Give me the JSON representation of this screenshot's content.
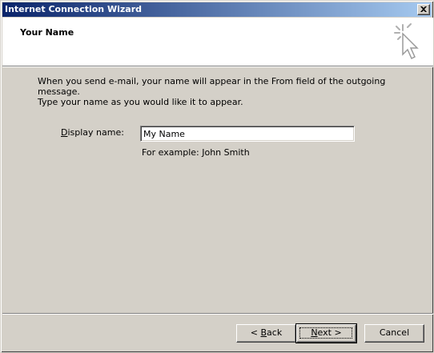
{
  "window": {
    "title": "Internet Connection Wizard"
  },
  "header": {
    "title": "Your Name"
  },
  "main": {
    "description_line1": "When you send e-mail, your name will appear in the From field of the outgoing message.",
    "description_line2": "Type your name as you would like it to appear.",
    "display_name_label_mnemonic": "D",
    "display_name_label_rest": "isplay name:",
    "display_name_value": "My Name",
    "example_text": "For example: John Smith"
  },
  "buttons": {
    "back_prefix": "< ",
    "back_mnemonic": "B",
    "back_rest": "ack",
    "next_mnemonic": "N",
    "next_rest": "ext >",
    "cancel_label": "Cancel"
  },
  "icons": {
    "close": "close-icon",
    "wizard": "wizard-cursor-icon"
  }
}
